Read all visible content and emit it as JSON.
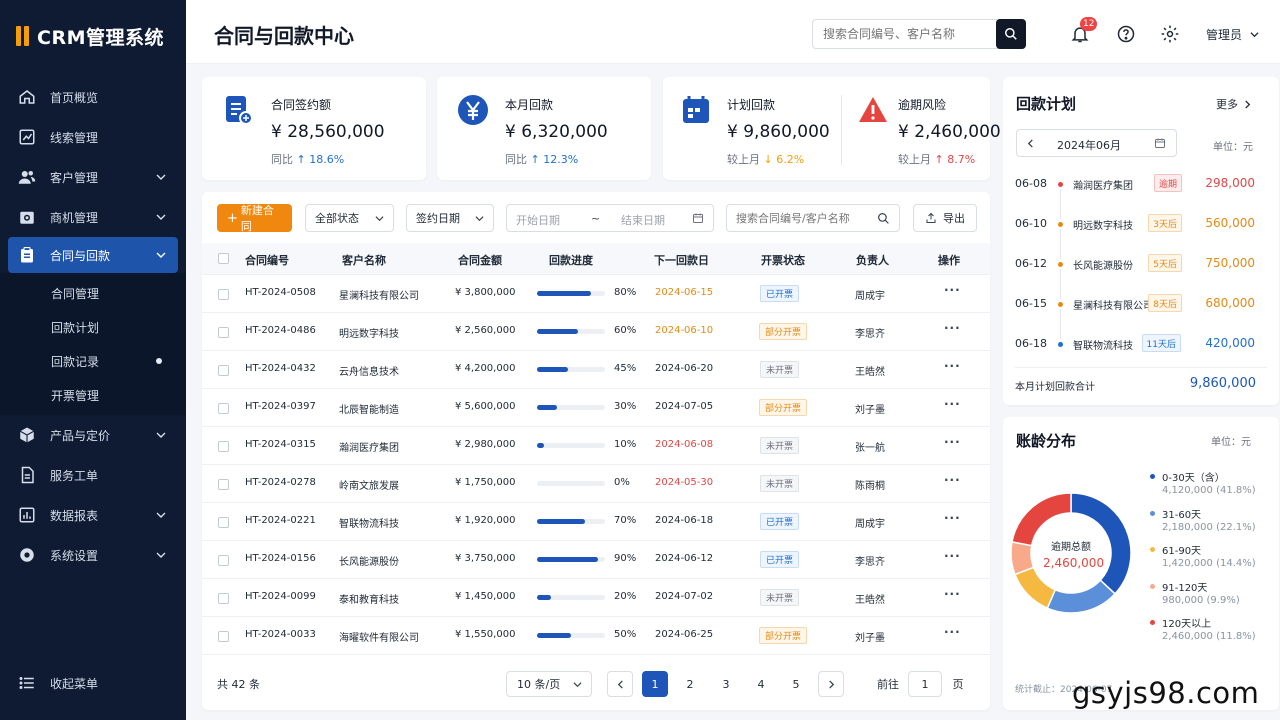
{
  "app": {
    "name": "CRM管理系统"
  },
  "sidebar": {
    "items": [
      {
        "label": "首页概览"
      },
      {
        "label": "线索管理"
      },
      {
        "label": "客户管理"
      },
      {
        "label": "商机管理"
      },
      {
        "label": "合同与回款"
      },
      {
        "label": "产品与定价"
      },
      {
        "label": "服务工单"
      },
      {
        "label": "数据报表"
      },
      {
        "label": "系统设置"
      }
    ],
    "sub_items": [
      {
        "label": "合同管理"
      },
      {
        "label": "回款计划"
      },
      {
        "label": "回款记录"
      },
      {
        "label": "开票管理"
      }
    ],
    "collapse_label": "收起菜单"
  },
  "header": {
    "title": "合同与回款中心",
    "search_placeholder": "搜索合同编号、客户名称",
    "notification_count": "12",
    "user": "管理员"
  },
  "kpis": [
    {
      "label": "合同签约额",
      "value": "¥ 28,560,000",
      "compare": "同比",
      "trend": "↑ 18.6%"
    },
    {
      "label": "本月回款",
      "value": "¥ 6,320,000",
      "compare": "同比",
      "trend": "↑ 12.3%"
    },
    {
      "label": "计划回款",
      "value": "¥ 9,860,000",
      "compare": "较上月",
      "trend": "↓ 6.2%"
    },
    {
      "label": "逾期风险",
      "value": "¥ 2,460,000",
      "compare": "较上月",
      "trend": "↑ 8.7%"
    }
  ],
  "toolbar": {
    "new_button": "新建合同",
    "status_filter": "全部状态",
    "date_type": "签约日期",
    "start_date": "开始日期",
    "range_sep": "~",
    "end_date": "结束日期",
    "search_placeholder": "搜索合同编号/客户名称",
    "export_button": "导出"
  },
  "table": {
    "columns": [
      "合同编号",
      "客户名称",
      "合同金额",
      "回款进度",
      "下一回款日",
      "开票状态",
      "负责人",
      "操作"
    ],
    "rows": [
      {
        "id": "HT-2024-0508",
        "customer": "星澜科技有限公司",
        "amount": "¥ 3,800,000",
        "progress": 80,
        "progress_text": "80%",
        "next_date": "2024-06-15",
        "date_status": "soon",
        "invoice": "已开票",
        "invoice_type": "blue",
        "owner": "周成宇"
      },
      {
        "id": "HT-2024-0486",
        "customer": "明远数字科技",
        "amount": "¥ 2,560,000",
        "progress": 60,
        "progress_text": "60%",
        "next_date": "2024-06-10",
        "date_status": "soon",
        "invoice": "部分开票",
        "invoice_type": "orange",
        "owner": "李思齐"
      },
      {
        "id": "HT-2024-0432",
        "customer": "云舟信息技术",
        "amount": "¥ 4,200,000",
        "progress": 45,
        "progress_text": "45%",
        "next_date": "2024-06-20",
        "date_status": "normal",
        "invoice": "未开票",
        "invoice_type": "gray",
        "owner": "王皓然"
      },
      {
        "id": "HT-2024-0397",
        "customer": "北辰智能制造",
        "amount": "¥ 5,600,000",
        "progress": 30,
        "progress_text": "30%",
        "next_date": "2024-07-05",
        "date_status": "normal",
        "invoice": "部分开票",
        "invoice_type": "orange",
        "owner": "刘子墨"
      },
      {
        "id": "HT-2024-0315",
        "customer": "瀚润医疗集团",
        "amount": "¥ 2,980,000",
        "progress": 10,
        "progress_text": "10%",
        "next_date": "2024-06-08",
        "date_status": "overdue",
        "invoice": "未开票",
        "invoice_type": "gray",
        "owner": "张一航"
      },
      {
        "id": "HT-2024-0278",
        "customer": "岭南文旅发展",
        "amount": "¥ 1,750,000",
        "progress": 0,
        "progress_text": "0%",
        "next_date": "2024-05-30",
        "date_status": "overdue",
        "invoice": "未开票",
        "invoice_type": "gray",
        "owner": "陈雨桐"
      },
      {
        "id": "HT-2024-0221",
        "customer": "智联物流科技",
        "amount": "¥ 1,920,000",
        "progress": 70,
        "progress_text": "70%",
        "next_date": "2024-06-18",
        "date_status": "normal",
        "invoice": "已开票",
        "invoice_type": "blue",
        "owner": "周成宇"
      },
      {
        "id": "HT-2024-0156",
        "customer": "长风能源股份",
        "amount": "¥ 3,750,000",
        "progress": 90,
        "progress_text": "90%",
        "next_date": "2024-06-12",
        "date_status": "normal",
        "invoice": "已开票",
        "invoice_type": "blue",
        "owner": "李思齐"
      },
      {
        "id": "HT-2024-0099",
        "customer": "泰和教育科技",
        "amount": "¥ 1,450,000",
        "progress": 20,
        "progress_text": "20%",
        "next_date": "2024-07-02",
        "date_status": "normal",
        "invoice": "未开票",
        "invoice_type": "gray",
        "owner": "王皓然"
      },
      {
        "id": "HT-2024-0033",
        "customer": "海曜软件有限公司",
        "amount": "¥ 1,550,000",
        "progress": 50,
        "progress_text": "50%",
        "next_date": "2024-06-25",
        "date_status": "normal",
        "invoice": "部分开票",
        "invoice_type": "orange",
        "owner": "刘子墨"
      }
    ],
    "action_label": "···",
    "total": "共 42 条",
    "page_size": "10 条/页",
    "pages": [
      "1",
      "2",
      "3",
      "4",
      "5"
    ],
    "goto_label": "前往",
    "goto_value": "1",
    "goto_suffix": "页"
  },
  "plan": {
    "title": "回款计划",
    "more": "更多",
    "month": "2024年06月",
    "unit": "单位：元",
    "items": [
      {
        "date": "06-08",
        "name": "瀚润医疗集团",
        "tag": "逾期",
        "tag_type": "red",
        "amount": "298,000"
      },
      {
        "date": "06-10",
        "name": "明远数字科技",
        "tag": "3天后",
        "tag_type": "orange",
        "amount": "560,000"
      },
      {
        "date": "06-12",
        "name": "长风能源股份",
        "tag": "5天后",
        "tag_type": "orange",
        "amount": "750,000"
      },
      {
        "date": "06-15",
        "name": "星澜科技有限公司",
        "tag": "8天后",
        "tag_type": "orange",
        "amount": "680,000"
      },
      {
        "date": "06-18",
        "name": "智联物流科技",
        "tag": "11天后",
        "tag_type": "blue",
        "amount": "420,000"
      }
    ],
    "total_label": "本月计划回款合计",
    "total_value": "9,860,000"
  },
  "aging": {
    "title": "账龄分布",
    "unit": "单位：元",
    "center_label": "逾期总额",
    "center_value": "2,460,000",
    "footer": "统计截止：2024-06-07"
  },
  "chart_data": {
    "type": "pie",
    "title": "账龄分布",
    "categories": [
      "0-30天（含）",
      "31-60天",
      "61-90天",
      "91-120天",
      "120天以上"
    ],
    "values": [
      4120000,
      2180000,
      1420000,
      980000,
      2460000
    ],
    "value_labels": [
      "4,120,000 (41.8%)",
      "2,180,000 (22.1%)",
      "1,420,000 (14.4%)",
      "980,000 (9.9%)",
      "2,460,000 (11.8%)"
    ],
    "colors": [
      "#1d56b8",
      "#5b8fd9",
      "#f5b942",
      "#f7a98a",
      "#e5453f"
    ],
    "legend": "right"
  },
  "watermark": "gsyjs98.com"
}
